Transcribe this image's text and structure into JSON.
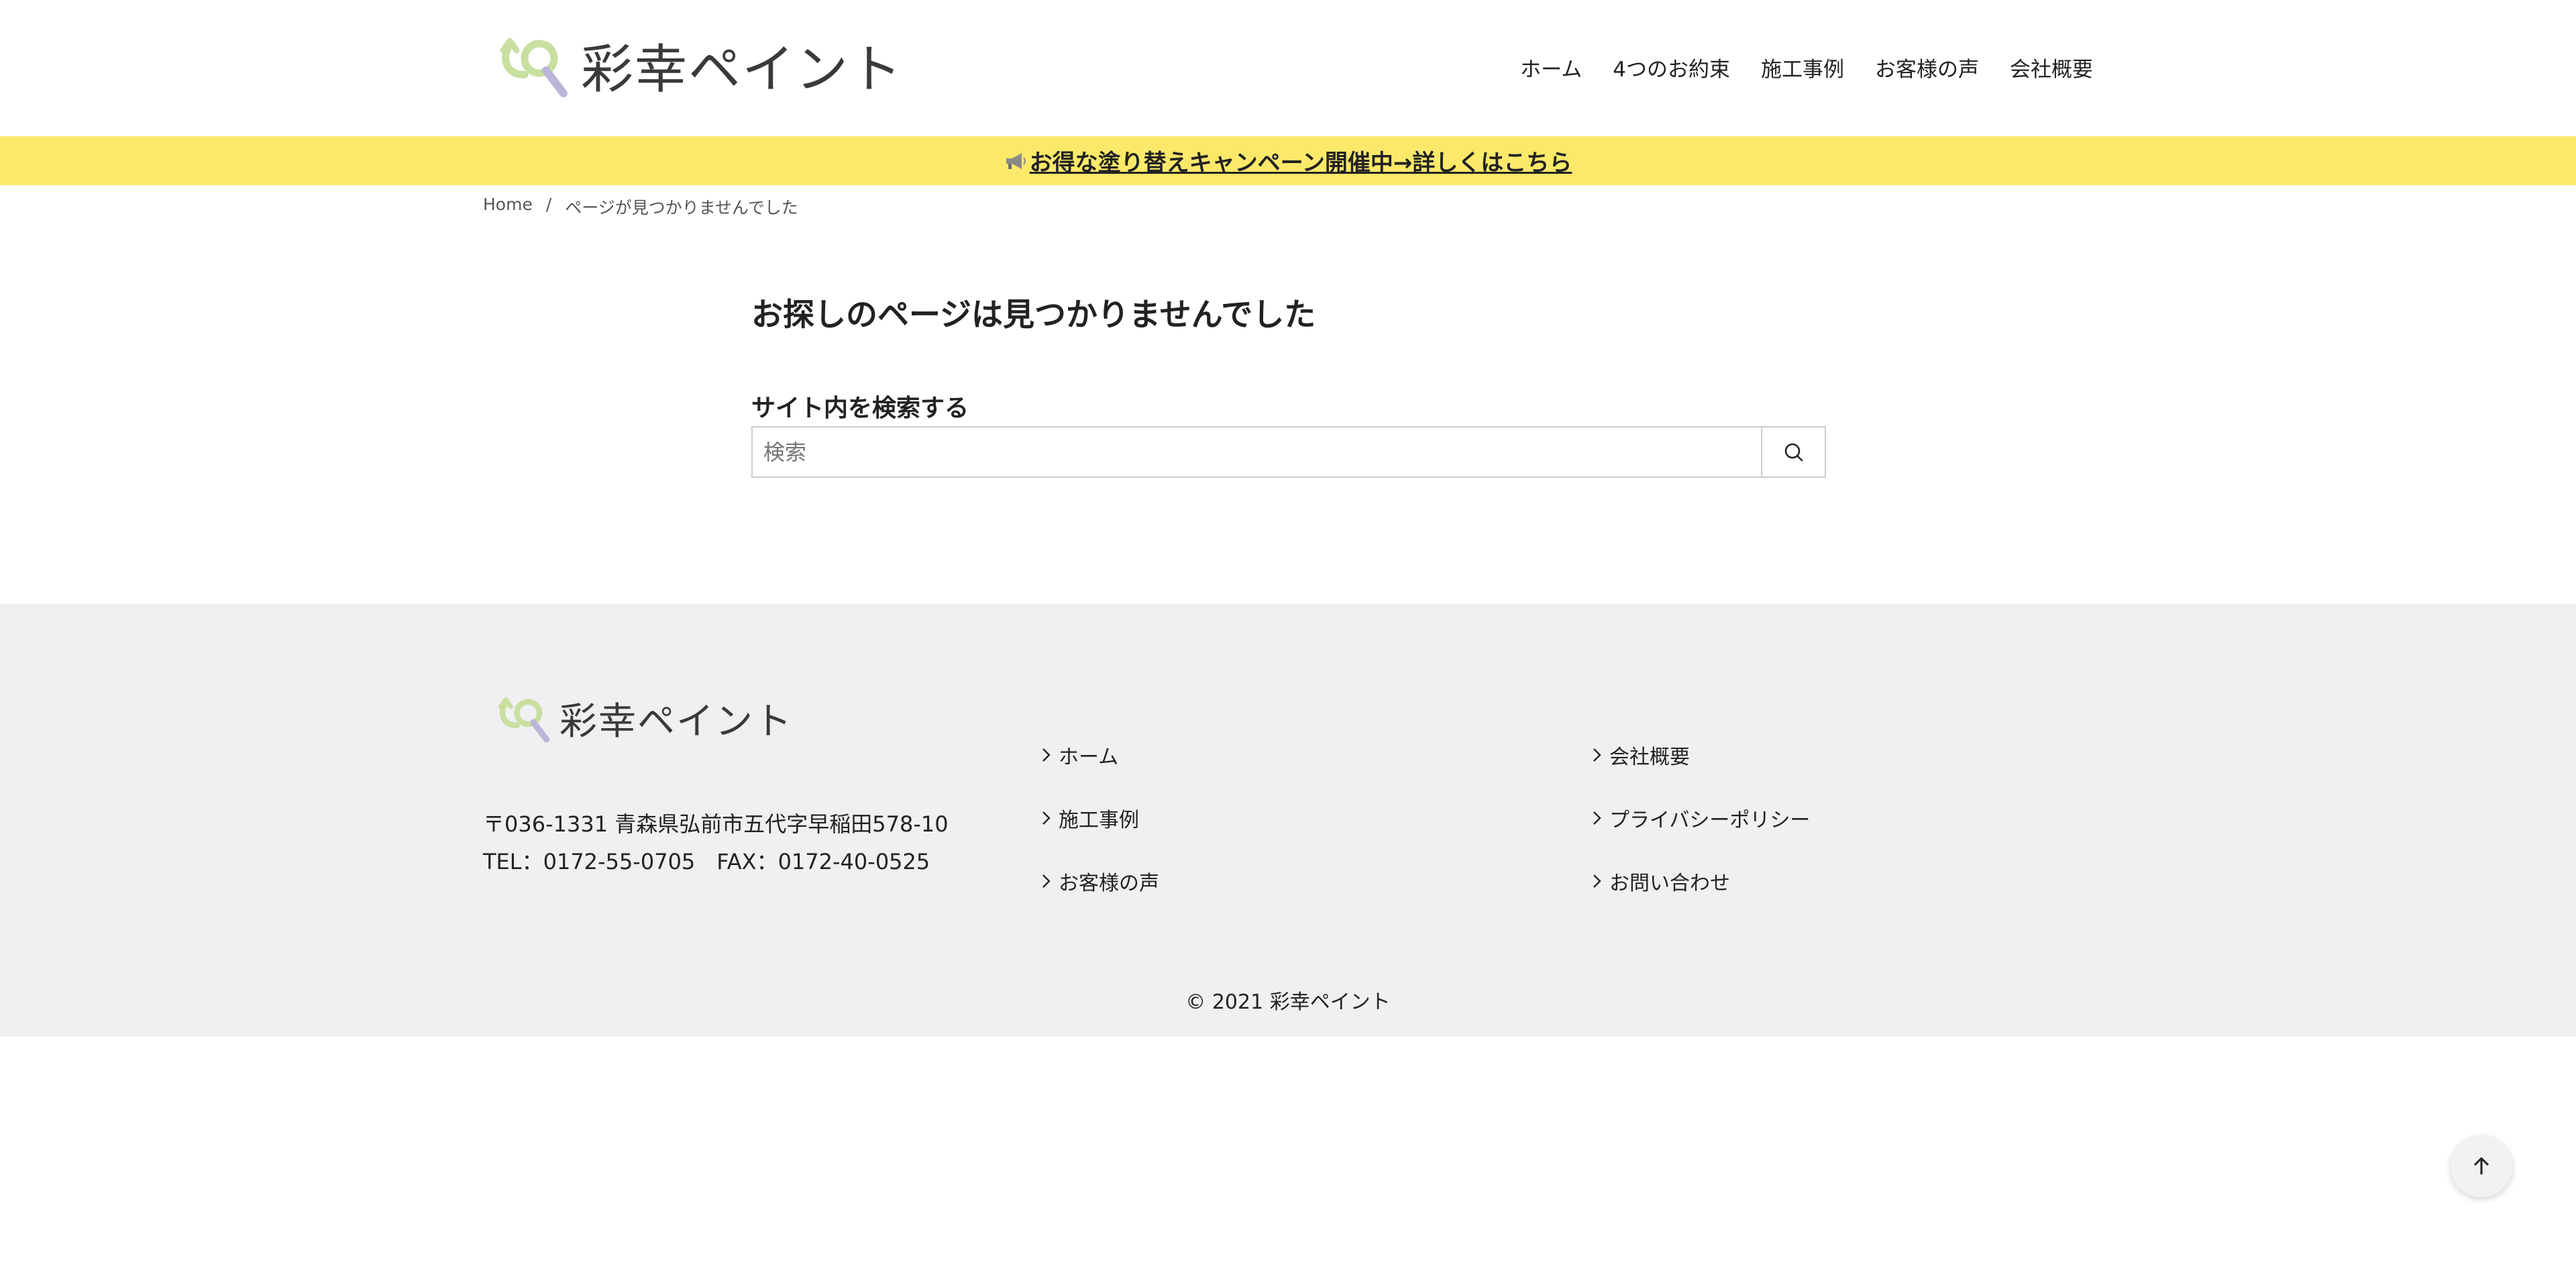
{
  "site": {
    "name": "彩幸ペイント",
    "logo_colors": {
      "green": "#c9dfa0",
      "purple": "#b9b6d9"
    }
  },
  "nav": [
    {
      "label": "ホーム"
    },
    {
      "label": "4つのお約束"
    },
    {
      "label": "施工事例"
    },
    {
      "label": "お客様の声"
    },
    {
      "label": "会社概要"
    }
  ],
  "banner": {
    "text": "お得な塗り替えキャンペーン開催中→詳しくはこちら",
    "icon": "megaphone-icon",
    "bg_color": "#fce96a"
  },
  "breadcrumb": {
    "home": "Home",
    "separator": "/",
    "current": "ページが見つかりませんでした"
  },
  "main": {
    "title": "お探しのページは見つかりませんでした",
    "search_heading": "サイト内を検索する",
    "search_placeholder": "検索",
    "search_value": "",
    "search_icon": "search-icon"
  },
  "footer": {
    "address": "〒036-1331 青森県弘前市五代字早稲田578-10",
    "contact": "TEL：0172-55-0705　FAX：0172-40-0525",
    "links_col1": [
      {
        "label": "ホーム"
      },
      {
        "label": "施工事例"
      },
      {
        "label": "お客様の声"
      }
    ],
    "links_col2": [
      {
        "label": "会社概要"
      },
      {
        "label": "プライバシーポリシー"
      },
      {
        "label": "お問い合わせ"
      }
    ],
    "copyright": "© 2021 彩幸ペイント",
    "bg_color": "#f0f0f2"
  },
  "back_to_top": {
    "icon": "arrow-up-icon"
  }
}
